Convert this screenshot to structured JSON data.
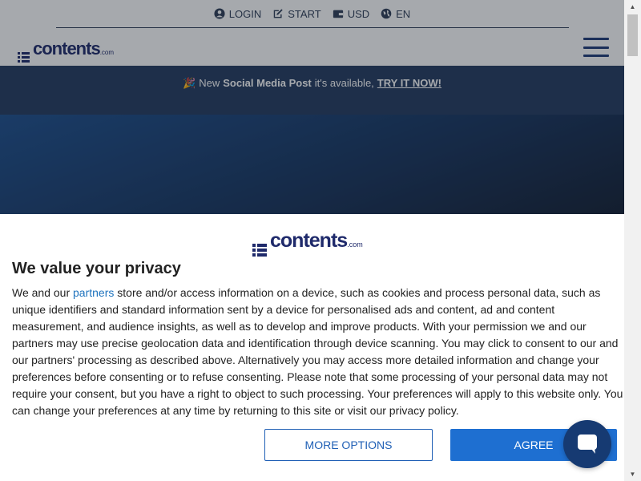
{
  "topnav": {
    "items": [
      {
        "label": "LOGIN",
        "icon": "user-circle-icon"
      },
      {
        "label": "START",
        "icon": "edit-icon"
      },
      {
        "label": "USD",
        "icon": "wallet-icon"
      },
      {
        "label": "EN",
        "icon": "globe-icon"
      }
    ]
  },
  "logo": {
    "word": "contents",
    "suffix": ".com"
  },
  "announcement": {
    "emoji": "🎉",
    "prefix": "New",
    "product": "Social Media Post",
    "middle": "it's available,",
    "cta": "TRY IT NOW!"
  },
  "consent": {
    "title": "We value your privacy",
    "body_before_link": "We and our ",
    "link": "partners",
    "body_after_link": " store and/or access information on a device, such as cookies and process personal data, such as unique identifiers and standard information sent by a device for personalised ads and content, ad and content measurement, and audience insights, as well as to develop and improve products. With your permission we and our partners may use precise geolocation data and identification through device scanning. You may click to consent to our and our partners' processing as described above. Alternatively you may access more detailed information and change your preferences before consenting or to refuse consenting. Please note that some processing of your personal data may not require your consent, but you have a right to object to such processing. Your preferences will apply to this website only. You can change your preferences at any time by returning to this site or visit our privacy policy.",
    "more_options_label": "MORE OPTIONS",
    "agree_label": "AGREE"
  },
  "colors": {
    "brand_navy": "#1f2a6b",
    "announce_bg": "#243a5f",
    "button_blue": "#1e6fd1",
    "link_blue": "#1e73be",
    "chat_bg": "#163a72"
  }
}
